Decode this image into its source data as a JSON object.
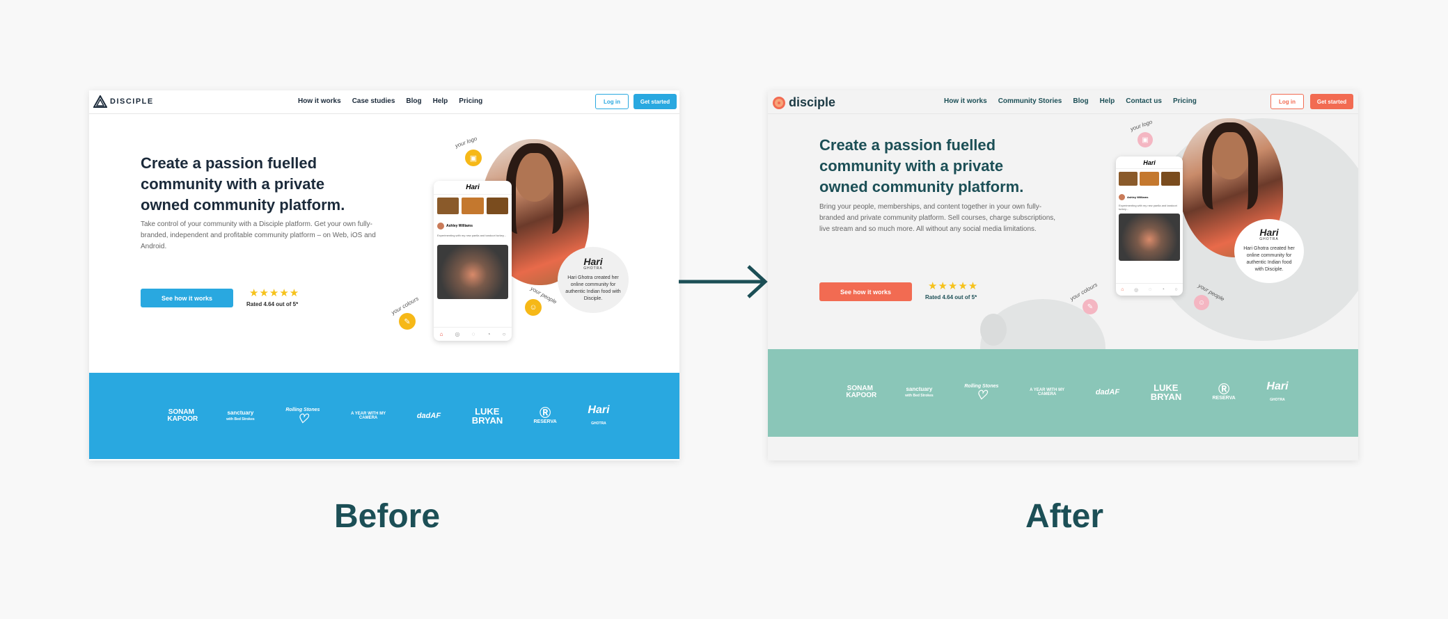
{
  "colors": {
    "page_bg": "#f8f8f8",
    "before_accent": "#29a8e0",
    "after_accent": "#f26b52",
    "after_teal_band": "#8ac6b8",
    "heading_after": "#1c4f56",
    "arrow": "#1c4f56"
  },
  "before": {
    "logo_text": "DISCIPLE",
    "nav": [
      "How it works",
      "Case studies",
      "Blog",
      "Help",
      "Pricing"
    ],
    "login": "Log in",
    "get_started": "Get started",
    "title": "Create a passion fuelled community with a private owned community platform.",
    "subtitle": "Take control of your community with a Disciple platform. Get your own fully-branded, independent and profitable community platform – on Web, iOS and Android.",
    "cta": "See how it works",
    "stars": "★★★★★",
    "rating": "Rated 4.64 out of 5*",
    "annot_logo": "your logo",
    "annot_colours": "your colours",
    "annot_people": "your people",
    "bubble_name": "Hari",
    "bubble_sub": "GHOTRA",
    "bubble_text": "Hari Ghotra created her online community for authentic Indian food with Disciple.",
    "brands": [
      "SONAM KAPOOR",
      "sanctuary",
      "Rolling Stones",
      "A YEAR WITH MY CAMERA",
      "dadAF",
      "LUKE BRYAN",
      "RESERVA",
      "Hari"
    ],
    "brand_sub": [
      "",
      "with Bed Strokes",
      "",
      "",
      "",
      "",
      "",
      "GHOTRA"
    ]
  },
  "after": {
    "logo_text": "disciple",
    "nav": [
      "How it works",
      "Community Stories",
      "Blog",
      "Help",
      "Contact us",
      "Pricing"
    ],
    "login": "Log in",
    "get_started": "Get started",
    "title": "Create a passion fuelled community with a private owned community platform.",
    "subtitle": "Bring your people, memberships, and content together in your own fully-branded and private community platform. Sell courses, charge subscriptions, live stream and so much more. All without any social media limitations.",
    "cta": "See how it works",
    "stars": "★★★★★",
    "rating": "Rated 4.64 out of 5*",
    "annot_logo": "your logo",
    "annot_colours": "your colours",
    "annot_people": "your people",
    "bubble_name": "Hari",
    "bubble_sub": "GHOTRA",
    "bubble_text": "Hari Ghotra created her online community for authentic Indian food with Disciple.",
    "brands": [
      "SONAM KAPOOR",
      "sanctuary",
      "Rolling Stones",
      "A YEAR WITH MY CAMERA",
      "dadAF",
      "LUKE BRYAN",
      "RESERVA",
      "Hari"
    ],
    "brand_sub": [
      "",
      "with Bed Strokes",
      "",
      "",
      "",
      "",
      "",
      "GHOTRA"
    ]
  },
  "phone": {
    "app_title": "Hari",
    "post_author": "Ashley Williams",
    "post_text": "Experimenting with my new paella and tandoori turkey..."
  },
  "labels": {
    "before": "Before",
    "after": "After"
  }
}
